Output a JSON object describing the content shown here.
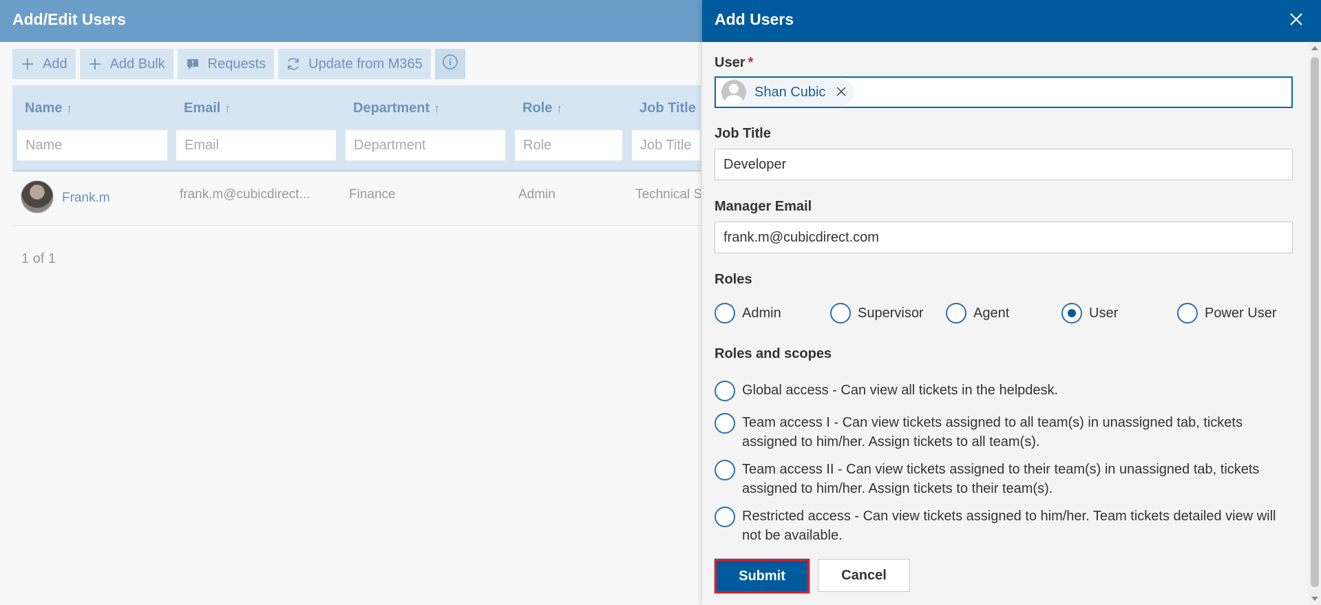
{
  "background": {
    "title": "Add/Edit Users",
    "toolbar": {
      "add": "Add",
      "add_bulk": "Add Bulk",
      "requests": "Requests",
      "update": "Update from M365"
    },
    "columns": [
      {
        "title": "Name",
        "sort": "↑",
        "filter_placeholder": "Name"
      },
      {
        "title": "Email",
        "sort": "↑",
        "filter_placeholder": "Email"
      },
      {
        "title": "Department",
        "sort": "↑",
        "filter_placeholder": "Department"
      },
      {
        "title": "Role",
        "sort": "↑",
        "filter_placeholder": "Role"
      },
      {
        "title": "Job Title",
        "sort": "",
        "filter_placeholder": "Job Title"
      }
    ],
    "rows": [
      {
        "name": "Frank.m",
        "email": "frank.m@cubicdirect...",
        "department": "Finance",
        "role": "Admin",
        "job_title": "Technical S"
      }
    ],
    "pager": "1 of 1"
  },
  "panel": {
    "title": "Add Users",
    "user_label": "User",
    "required_mark": "*",
    "user_chip": "Shan Cubic",
    "job_title_label": "Job Title",
    "job_title_value": "Developer",
    "manager_email_label": "Manager Email",
    "manager_email_value": "frank.m@cubicdirect.com",
    "roles_label": "Roles",
    "roles": [
      {
        "label": "Admin",
        "checked": false
      },
      {
        "label": "Supervisor",
        "checked": false
      },
      {
        "label": "Agent",
        "checked": false
      },
      {
        "label": "User",
        "checked": true
      },
      {
        "label": "Power User",
        "checked": false
      }
    ],
    "scopes_label": "Roles and scopes",
    "scopes": [
      {
        "label": "Global access - Can view all tickets in the helpdesk.",
        "checked": false
      },
      {
        "label": "Team access I - Can view tickets assigned to all team(s) in unassigned tab, tickets assigned to him/her. Assign tickets to all team(s).",
        "checked": false
      },
      {
        "label": "Team access II - Can view tickets assigned to their team(s) in unassigned tab, tickets assigned to him/her. Assign tickets to their team(s).",
        "checked": false
      },
      {
        "label": "Restricted access - Can view tickets assigned to him/her. Team tickets detailed view will not be available.",
        "checked": false
      }
    ],
    "submit": "Submit",
    "cancel": "Cancel"
  },
  "colors": {
    "panel_header": "#005a9e",
    "page_header": "#6a9dc7",
    "radio_border": "#2b6fb0",
    "submit_highlight": "#e01b24"
  },
  "icons": [
    "plus-icon",
    "comment-icon",
    "refresh-icon",
    "info-icon",
    "close-icon",
    "person-icon"
  ]
}
